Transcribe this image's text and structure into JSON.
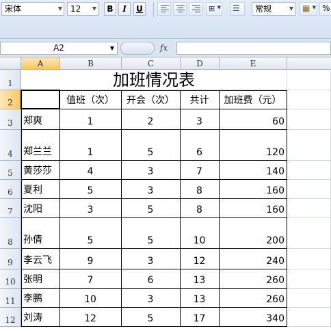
{
  "ribbon": {
    "font_name": "宋体",
    "font_size": "12",
    "bold": "B",
    "italic": "I",
    "underline": "U",
    "number_format": "常规",
    "percent": "%"
  },
  "formula_bar": {
    "name_box": "A2",
    "fx": "fx",
    "formula": ""
  },
  "columns": [
    "A",
    "B",
    "C",
    "D",
    "E"
  ],
  "rows": [
    "1",
    "2",
    "3",
    "4",
    "5",
    "6",
    "7",
    "8",
    "9",
    "10",
    "11",
    "12"
  ],
  "sheet": {
    "title": "加班情况表",
    "headers": [
      "",
      "值班（次）",
      "开会（次）",
      "共计",
      "加班费（元）"
    ],
    "records": [
      [
        "郑爽",
        "1",
        "2",
        "3",
        "60"
      ],
      [
        "郑兰兰",
        "1",
        "5",
        "6",
        "120"
      ],
      [
        "黄莎莎",
        "4",
        "3",
        "7",
        "140"
      ],
      [
        "夏利",
        "5",
        "3",
        "8",
        "160"
      ],
      [
        "沈阳",
        "3",
        "5",
        "8",
        "160"
      ],
      [
        "孙倩",
        "5",
        "5",
        "10",
        "200"
      ],
      [
        "李云飞",
        "9",
        "3",
        "12",
        "240"
      ],
      [
        "张明",
        "7",
        "6",
        "13",
        "260"
      ],
      [
        "李鹏",
        "10",
        "3",
        "13",
        "260"
      ],
      [
        "刘涛",
        "12",
        "5",
        "17",
        "340"
      ]
    ]
  },
  "colors": {
    "ribbon_bg": "#d6e2f3",
    "header_selected": "#f8c95a",
    "grid_line": "#d0d7e5"
  }
}
